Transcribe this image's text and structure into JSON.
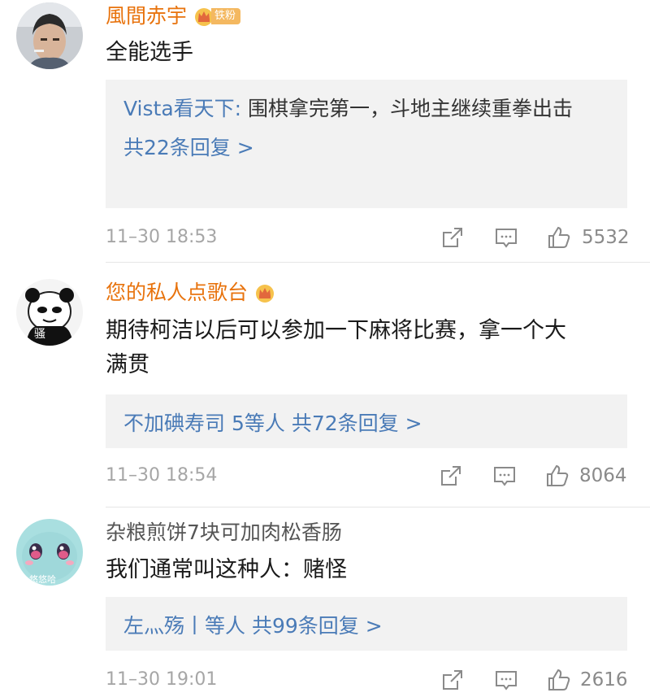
{
  "comments": [
    {
      "username": "風間赤宇",
      "fan_badge": "铁粉",
      "content": "全能选手",
      "reply": {
        "author": "Vista看天下:",
        "text": " 围棋拿完第一，斗地主继续重拳出击",
        "more": "共22条回复 >"
      },
      "time": "11–30 18:53",
      "likes": "5532"
    },
    {
      "username": "您的私人点歌台",
      "avatar_text": "骚",
      "content_line1": "期待柯洁以后可以参加一下麻将比赛，拿一个大",
      "content_line2": "满贯",
      "reply": {
        "author": "不加碘寿司",
        "middle": " 5等人 ",
        "more": "共72条回复 >"
      },
      "time": "11–30 18:54",
      "likes": "8064"
    },
    {
      "username": "杂粮煎饼7块可加肉松香肠",
      "avatar_text": "悠悠哈",
      "content": "我们通常叫这种人：赌怪",
      "reply": {
        "author": "左灬殇丨",
        "middle": "等人 ",
        "more": "共99条回复 >"
      },
      "time": "11–30 19:01",
      "likes": "2616"
    }
  ],
  "colors": {
    "username_orange": "#e8730d",
    "link_blue": "#4a7bb7",
    "reply_bg": "#f2f2f2",
    "meta_gray": "#a6a6a6"
  }
}
